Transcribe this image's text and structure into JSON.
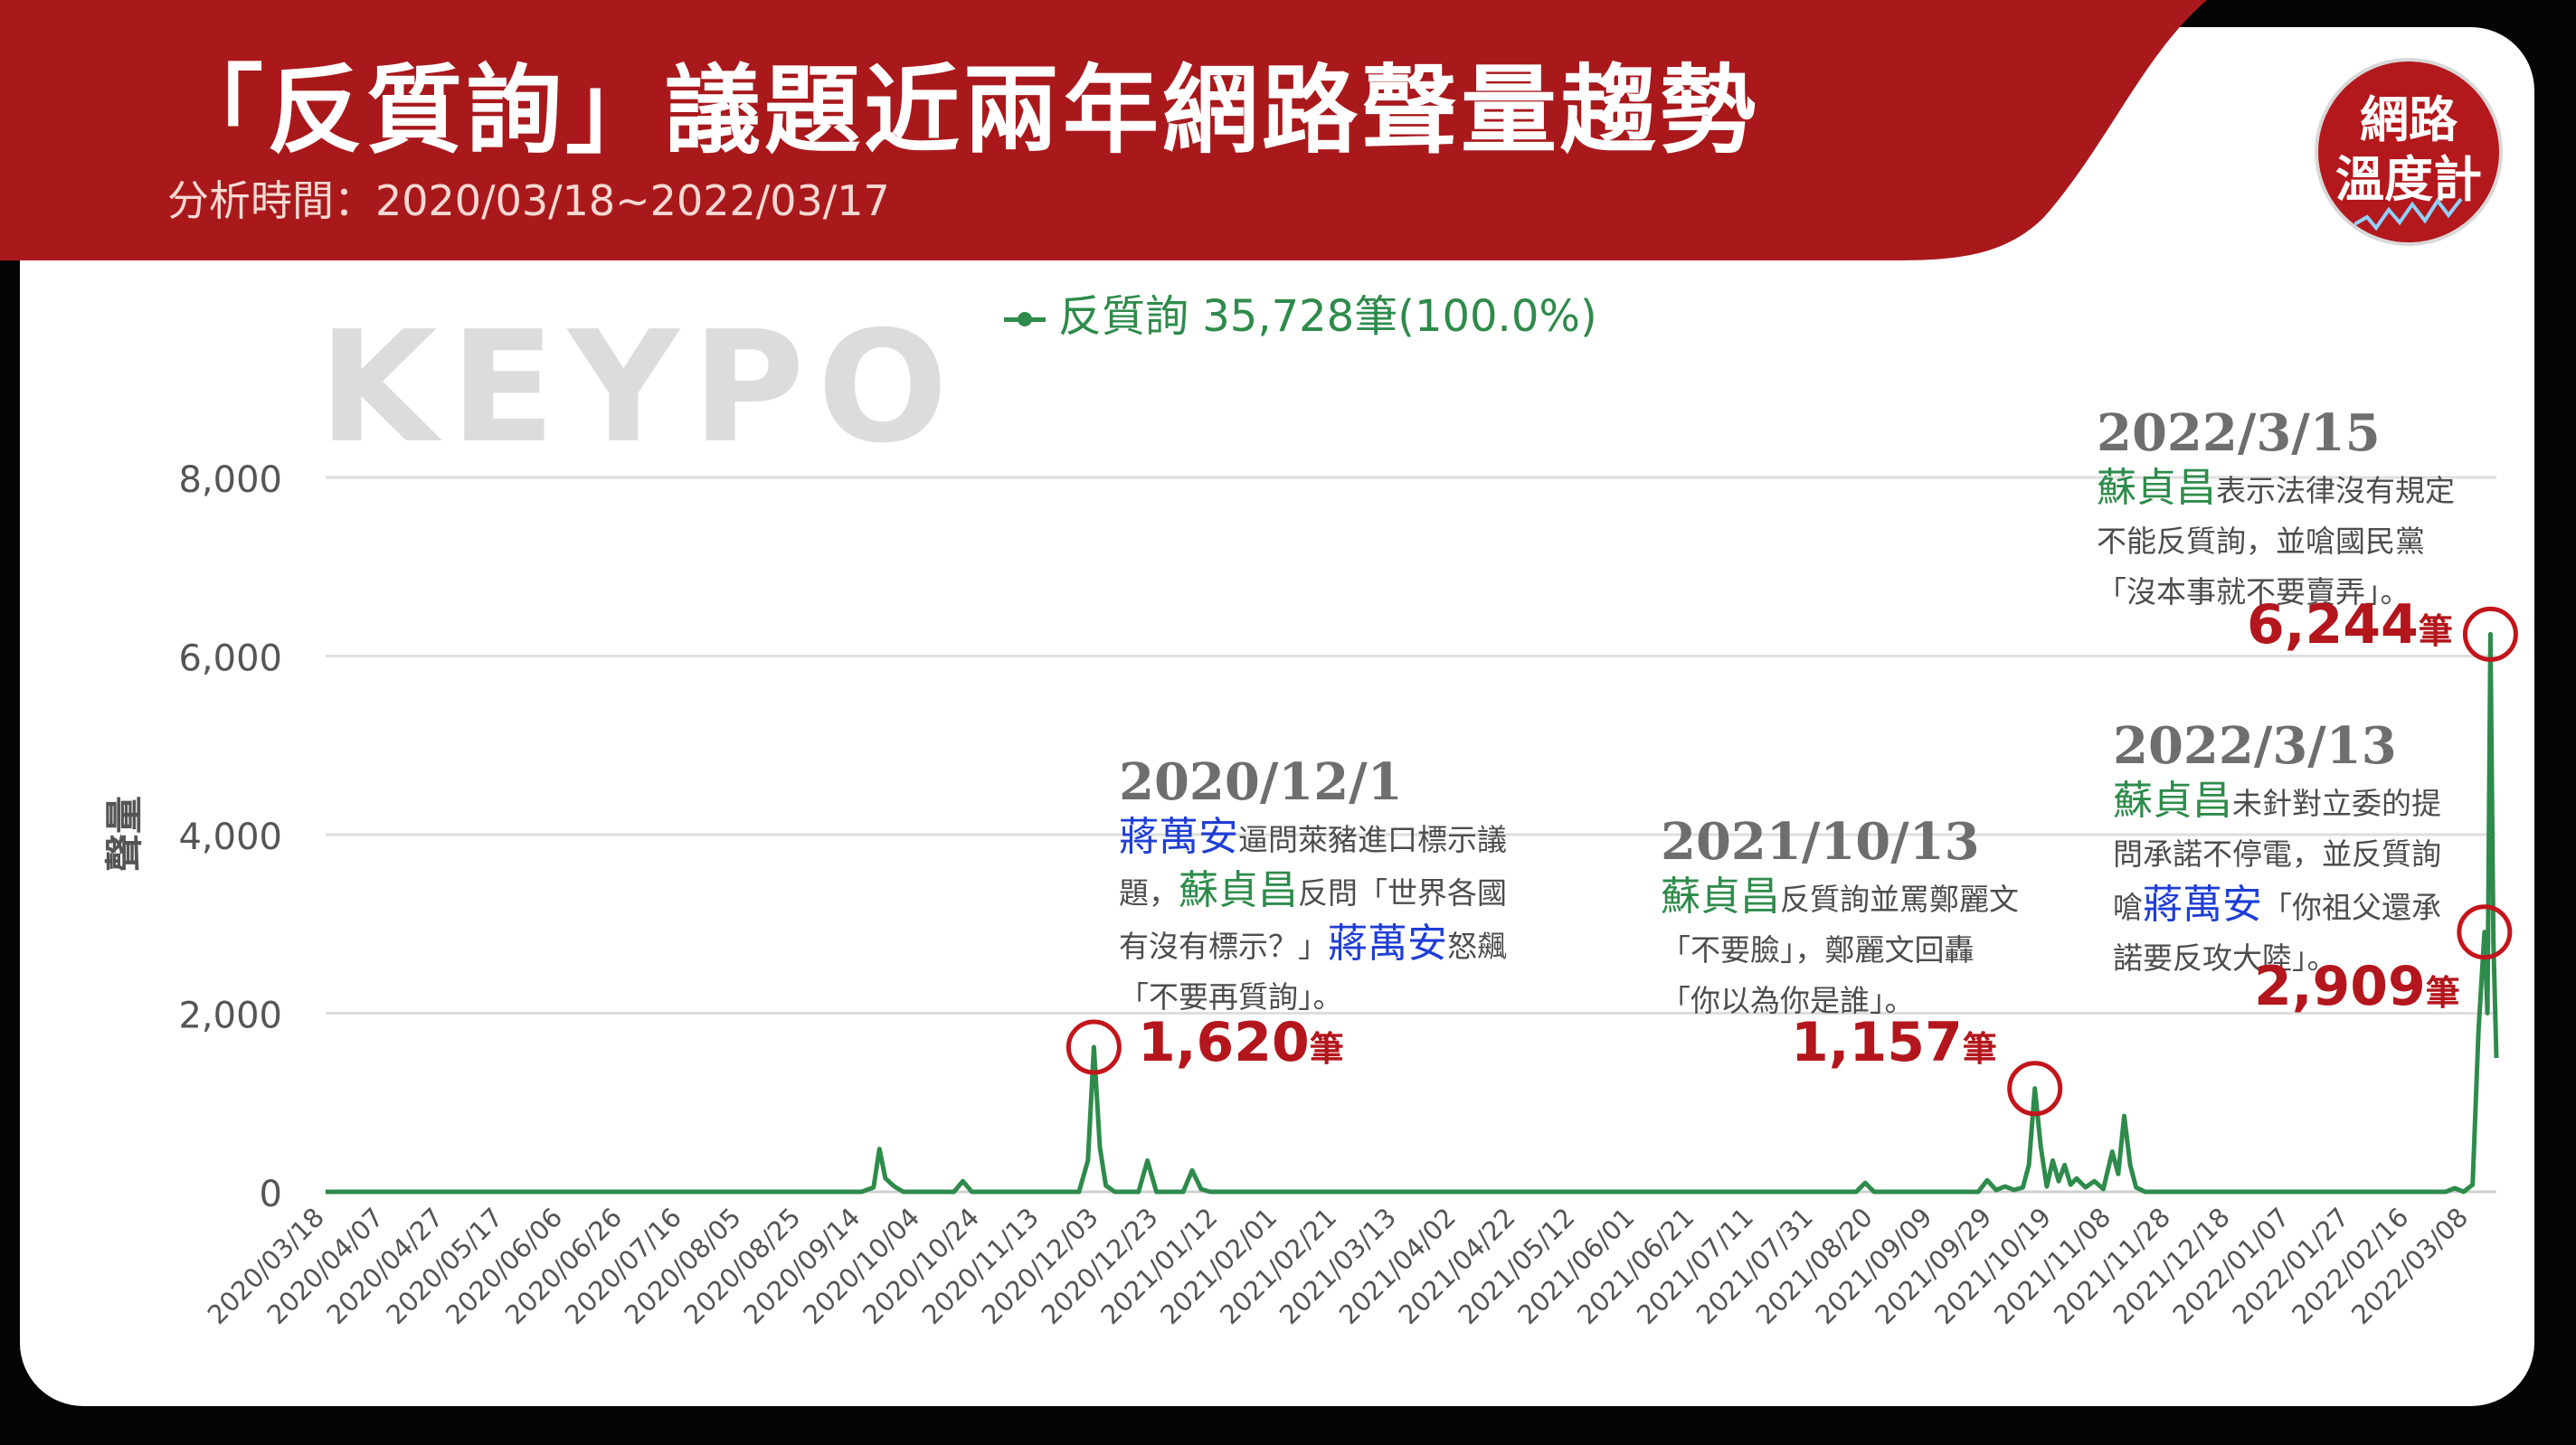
{
  "header": {
    "title": "「反質詢」議題近兩年網路聲量趨勢",
    "subtitle": "分析時間：2020/03/18~2022/03/17"
  },
  "badge": {
    "line1": "網路",
    "line2": "溫度計"
  },
  "watermark": "KEYPO",
  "legend": {
    "label": "反質詢 35,728筆(100.0%)"
  },
  "colors": {
    "brand_red": "#a9191c",
    "series_green": "#2e8b4b",
    "highlight_red": "#b3161c",
    "name_blue": "#1f3ed6",
    "name_green": "#2e8b4b"
  },
  "annotations": [
    {
      "date": "2020/12/1",
      "lines": [
        [
          {
            "t": "蔣萬安",
            "c": "b"
          },
          {
            "t": "逼問萊豬進口標示議",
            "c": ""
          }
        ],
        [
          {
            "t": "題，",
            "c": ""
          },
          {
            "t": "蘇貞昌",
            "c": "g"
          },
          {
            "t": "反問「世界各國",
            "c": ""
          }
        ],
        [
          {
            "t": "有沒有標示？」",
            "c": ""
          },
          {
            "t": "蔣萬安",
            "c": "b"
          },
          {
            "t": "怒飆",
            "c": ""
          }
        ],
        [
          {
            "t": "「不要再質詢」。",
            "c": ""
          }
        ]
      ],
      "count": "1,620",
      "unit": "筆"
    },
    {
      "date": "2021/10/13",
      "lines": [
        [
          {
            "t": "蘇貞昌",
            "c": "g"
          },
          {
            "t": "反質詢並罵鄭麗文",
            "c": ""
          }
        ],
        [
          {
            "t": "「不要臉」，鄭麗文回轟",
            "c": ""
          }
        ],
        [
          {
            "t": "「你以為你是誰」。",
            "c": ""
          }
        ]
      ],
      "count": "1,157",
      "unit": "筆"
    },
    {
      "date": "2022/3/15",
      "lines": [
        [
          {
            "t": "蘇貞昌",
            "c": "g"
          },
          {
            "t": "表示法律沒有規定",
            "c": ""
          }
        ],
        [
          {
            "t": "不能反質詢，並嗆國民黨",
            "c": ""
          }
        ],
        [
          {
            "t": "「沒本事就不要賣弄」。",
            "c": ""
          }
        ]
      ],
      "count": "6,244",
      "unit": "筆"
    },
    {
      "date": "2022/3/13",
      "lines": [
        [
          {
            "t": "蘇貞昌",
            "c": "g"
          },
          {
            "t": "未針對立委的提",
            "c": ""
          }
        ],
        [
          {
            "t": "問承諾不停電，並反質詢",
            "c": ""
          }
        ],
        [
          {
            "t": "嗆",
            "c": ""
          },
          {
            "t": "蔣萬安",
            "c": "b"
          },
          {
            "t": "「你祖父還承",
            "c": ""
          }
        ],
        [
          {
            "t": "諾要反攻大陸」。",
            "c": ""
          }
        ]
      ],
      "count": "2,909",
      "unit": "筆"
    }
  ],
  "chart_data": {
    "type": "line",
    "ylabel": "聲量",
    "ylim": [
      0,
      8000
    ],
    "yticks": [
      0,
      2000,
      4000,
      6000,
      8000
    ],
    "ytick_labels": [
      "0",
      "2,000",
      "4,000",
      "6,000",
      "8,000"
    ],
    "xlim": [
      "2020/03/18",
      "2022/03/17"
    ],
    "xtick_labels": [
      "2020/03/18",
      "2020/04/07",
      "2020/04/27",
      "2020/05/17",
      "2020/06/06",
      "2020/06/26",
      "2020/07/16",
      "2020/08/05",
      "2020/08/25",
      "2020/09/14",
      "2020/10/04",
      "2020/10/24",
      "2020/11/13",
      "2020/12/03",
      "2020/12/23",
      "2021/01/12",
      "2021/02/01",
      "2021/02/21",
      "2021/03/13",
      "2021/04/02",
      "2021/04/22",
      "2021/05/12",
      "2021/06/01",
      "2021/06/21",
      "2021/07/11",
      "2021/07/31",
      "2021/08/20",
      "2021/09/09",
      "2021/09/29",
      "2021/10/19",
      "2021/11/08",
      "2021/11/28",
      "2021/12/18",
      "2022/01/07",
      "2022/01/27",
      "2022/02/16",
      "2022/03/08"
    ],
    "grid": true,
    "series": [
      {
        "name": "反質詢",
        "total": "35,728筆(100.0%)",
        "points": [
          [
            "2020/03/18",
            0
          ],
          [
            "2020/09/14",
            0
          ],
          [
            "2020/09/18",
            50
          ],
          [
            "2020/09/20",
            480
          ],
          [
            "2020/09/22",
            150
          ],
          [
            "2020/09/25",
            60
          ],
          [
            "2020/09/28",
            0
          ],
          [
            "2020/10/15",
            0
          ],
          [
            "2020/10/18",
            120
          ],
          [
            "2020/10/21",
            0
          ],
          [
            "2020/11/26",
            0
          ],
          [
            "2020/11/29",
            350
          ],
          [
            "2020/12/01",
            1620
          ],
          [
            "2020/12/03",
            500
          ],
          [
            "2020/12/05",
            70
          ],
          [
            "2020/12/08",
            0
          ],
          [
            "2020/12/16",
            0
          ],
          [
            "2020/12/19",
            350
          ],
          [
            "2020/12/22",
            0
          ],
          [
            "2020/12/31",
            0
          ],
          [
            "2021/01/03",
            240
          ],
          [
            "2021/01/06",
            30
          ],
          [
            "2021/01/09",
            0
          ],
          [
            "2021/08/14",
            0
          ],
          [
            "2021/08/17",
            100
          ],
          [
            "2021/08/20",
            0
          ],
          [
            "2021/09/24",
            0
          ],
          [
            "2021/09/27",
            130
          ],
          [
            "2021/09/30",
            20
          ],
          [
            "2021/10/03",
            60
          ],
          [
            "2021/10/06",
            20
          ],
          [
            "2021/10/09",
            50
          ],
          [
            "2021/10/11",
            300
          ],
          [
            "2021/10/13",
            1157
          ],
          [
            "2021/10/15",
            500
          ],
          [
            "2021/10/17",
            60
          ],
          [
            "2021/10/19",
            350
          ],
          [
            "2021/10/21",
            120
          ],
          [
            "2021/10/23",
            300
          ],
          [
            "2021/10/25",
            80
          ],
          [
            "2021/10/27",
            150
          ],
          [
            "2021/10/30",
            50
          ],
          [
            "2021/11/02",
            120
          ],
          [
            "2021/11/05",
            30
          ],
          [
            "2021/11/08",
            450
          ],
          [
            "2021/11/10",
            200
          ],
          [
            "2021/11/12",
            850
          ],
          [
            "2021/11/14",
            300
          ],
          [
            "2021/11/16",
            50
          ],
          [
            "2021/11/19",
            0
          ],
          [
            "2022/02/28",
            0
          ],
          [
            "2022/03/03",
            40
          ],
          [
            "2022/03/06",
            0
          ],
          [
            "2022/03/09",
            80
          ],
          [
            "2022/03/11",
            1800
          ],
          [
            "2022/03/13",
            2909
          ],
          [
            "2022/03/14",
            2000
          ],
          [
            "2022/03/15",
            6244
          ],
          [
            "2022/03/16",
            2800
          ],
          [
            "2022/03/17",
            1500
          ]
        ]
      }
    ],
    "highlights": [
      {
        "date": "2020/12/01",
        "value": 1620
      },
      {
        "date": "2021/10/13",
        "value": 1157
      },
      {
        "date": "2022/03/13",
        "value": 2909
      },
      {
        "date": "2022/03/15",
        "value": 6244
      }
    ]
  }
}
